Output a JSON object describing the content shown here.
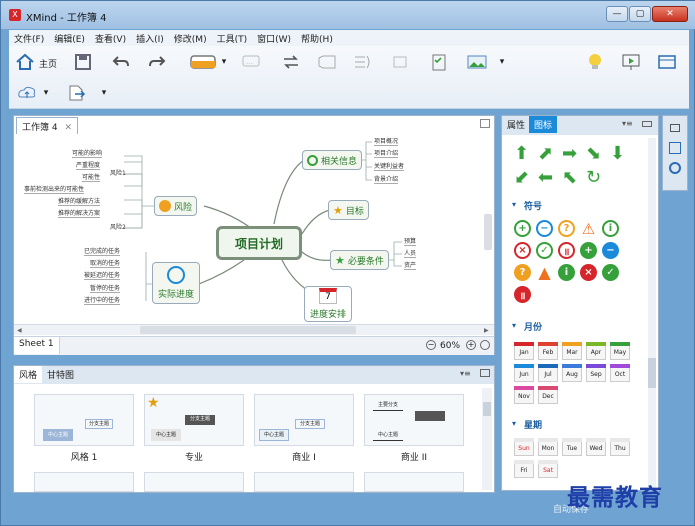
{
  "window": {
    "title": "XMind - 工作簿 4",
    "app_icon": "X"
  },
  "window_buttons": {
    "minimize": "—",
    "maximize": "▢",
    "close": "✕"
  },
  "menu": [
    "文件(F)",
    "编辑(E)",
    "查看(V)",
    "插入(I)",
    "修改(M)",
    "工具(T)",
    "窗口(W)",
    "帮助(H)"
  ],
  "toolbar": {
    "home_label": "主页"
  },
  "editor": {
    "tab_label": "工作簿 4",
    "central_topic": "项目计划",
    "topics": {
      "risk": "风险",
      "related": "相关信息",
      "goal": "目标",
      "prereq": "必要条件",
      "progress": "实际进度",
      "schedule": "进度安排"
    },
    "risk_groups": {
      "r1": "风险1",
      "r2": "风险2"
    },
    "risk_items": [
      "可能的影响",
      "严重程度",
      "可能性",
      "事前检测出来的可能性",
      "推荐的缓解方法",
      "推荐的解决方案"
    ],
    "related_items": [
      "项目概况",
      "项目介绍",
      "关键利益者",
      "背景介绍"
    ],
    "prereq_items": [
      "预算",
      "人员",
      "资产"
    ],
    "progress_items": [
      "已完成的任务",
      "取消的任务",
      "被延迟的任务",
      "暂停的任务",
      "进行中的任务"
    ],
    "calendar_day": "7",
    "sheet_tab": "Sheet 1",
    "zoom": "60%"
  },
  "style_panel": {
    "tabs": [
      "风格",
      "甘特图"
    ],
    "styles": [
      "风格 1",
      "专业",
      "商业 I",
      "商业 II"
    ],
    "thumb_text": {
      "center": "中心主题",
      "sub": "分支主题",
      "main": "主要分支"
    }
  },
  "right_panel": {
    "tabs": [
      "属性",
      "图标"
    ],
    "symbols_title": "符号",
    "months_title": "月份",
    "weeks_title": "星期",
    "months": [
      "Jan",
      "Feb",
      "Mar",
      "Apr",
      "May",
      "Jun",
      "Jul",
      "Aug",
      "Sep",
      "Oct",
      "Nov",
      "Dec"
    ],
    "weekdays": [
      "Sun",
      "Mon",
      "Tue",
      "Wed",
      "Thu",
      "Fri",
      "Sat"
    ]
  },
  "statusbar": {
    "text": "自动保存"
  },
  "watermark": "最需教育",
  "colors": {
    "accent": "#1b8ad9",
    "green": "#36a03a",
    "red": "#d6262b",
    "orange": "#f0a020"
  }
}
